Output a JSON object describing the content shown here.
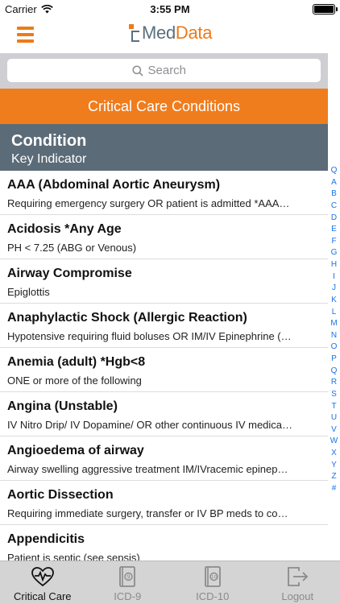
{
  "status": {
    "carrier": "Carrier",
    "time": "3:55 PM",
    "battery_level": 1.0
  },
  "header": {
    "logo_med": "Med",
    "logo_data": "Data"
  },
  "search": {
    "placeholder": "Search"
  },
  "section_title": "Critical Care Conditions",
  "columns": {
    "primary": "Condition",
    "secondary": "Key Indicator"
  },
  "conditions": [
    {
      "title": "AAA (Abdominal Aortic Aneurysm)",
      "indicator": "Requiring emergency surgery OR patient is admitted *AAA…"
    },
    {
      "title": "Acidosis *Any Age",
      "indicator": "PH < 7.25 (ABG or Venous)"
    },
    {
      "title": "Airway Compromise",
      "indicator": "Epiglottis"
    },
    {
      "title": "Anaphylactic Shock (Allergic Reaction)",
      "indicator": "Hypotensive requiring fluid boluses OR IM/IV Epinephrine (…"
    },
    {
      "title": "Anemia (adult) *Hgb<8",
      "indicator": "ONE or more of the following"
    },
    {
      "title": "Angina (Unstable)",
      "indicator": "IV Nitro Drip/ IV Dopamine/ OR other continuous IV medica…"
    },
    {
      "title": "Angioedema of airway",
      "indicator": "Airway swelling aggressive treatment IM/IVracemic epinep…"
    },
    {
      "title": "Aortic Dissection",
      "indicator": "Requiring immediate surgery, transfer or IV BP meds to co…"
    },
    {
      "title": "Appendicitis",
      "indicator": "Patient is septic (see sepsis)"
    }
  ],
  "index_letters": [
    "Q",
    "A",
    "B",
    "C",
    "D",
    "E",
    "F",
    "G",
    "H",
    "I",
    "J",
    "K",
    "L",
    "M",
    "N",
    "O",
    "P",
    "Q",
    "R",
    "S",
    "T",
    "U",
    "V",
    "W",
    "X",
    "Y",
    "Z",
    "#"
  ],
  "tabs": [
    {
      "label": "Critical Care",
      "icon": "heart-pulse-icon",
      "active": true
    },
    {
      "label": "ICD-9",
      "icon": "book-9-icon",
      "active": false
    },
    {
      "label": "ICD-10",
      "icon": "book-10-icon",
      "active": false
    },
    {
      "label": "Logout",
      "icon": "logout-icon",
      "active": false
    }
  ],
  "colors": {
    "accent": "#ef7d1e",
    "header": "#5b6b77",
    "index": "#1a73e8"
  }
}
